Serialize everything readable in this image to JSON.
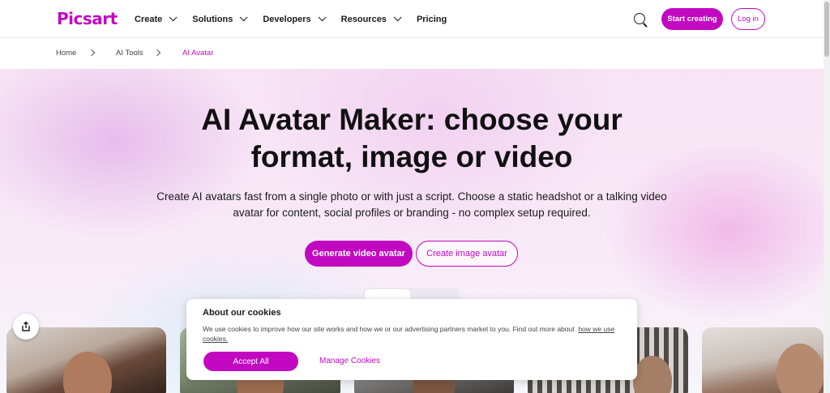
{
  "brand": {
    "logo": "Picsart",
    "accent": "#c209c1"
  },
  "nav": {
    "items": [
      {
        "label": "Create",
        "has_dropdown": true
      },
      {
        "label": "Solutions",
        "has_dropdown": true
      },
      {
        "label": "Developers",
        "has_dropdown": true
      },
      {
        "label": "Resources",
        "has_dropdown": true
      },
      {
        "label": "Pricing",
        "has_dropdown": false
      }
    ],
    "start_label": "Start creating",
    "login_label": "Log in"
  },
  "breadcrumb": [
    "Home",
    "AI Tools",
    "AI Avatar"
  ],
  "hero": {
    "title_line1": "AI Avatar Maker: choose your",
    "title_line2": "format, image or video",
    "subtitle": "Create AI avatars fast from a single photo or with just a script. Choose a static headshot or a talking video avatar for content, social profiles or branding - no complex setup required.",
    "primary_cta": "Generate video avatar",
    "secondary_cta": "Create image avatar"
  },
  "cookie": {
    "title": "About our cookies",
    "text": "We use cookies to improve how our site works and how we or our advertising partners market to you. Find out more about",
    "link": "how we use cookies.",
    "accept": "Accept All",
    "manage": "Manage Cookies"
  }
}
